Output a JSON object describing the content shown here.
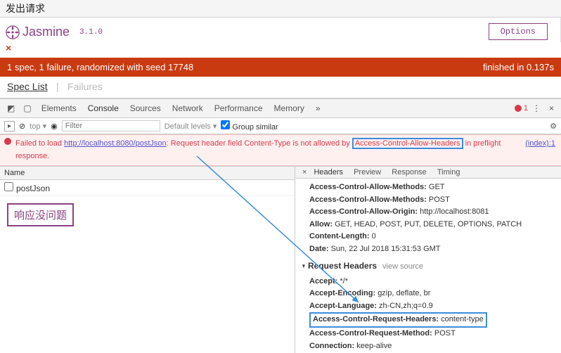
{
  "page": {
    "title": "发出请求"
  },
  "jasmine": {
    "name": "Jasmine",
    "version": "3.1.0",
    "options_label": "Options",
    "fail_mark": "×",
    "status_text": "1 spec, 1 failure, randomized with seed 17748",
    "finished_text": "finished in 0.137s",
    "spec_list_label": "Spec List",
    "failures_label": "Failures"
  },
  "devtools": {
    "tabs": [
      "Elements",
      "Console",
      "Sources",
      "Network",
      "Performance",
      "Memory"
    ],
    "active_tab": "Console",
    "overflow": "»",
    "error_count": "1",
    "more": "⋮",
    "close": "×"
  },
  "filter": {
    "context_label": "top",
    "filter_placeholder": "Filter",
    "levels_label": "Default levels",
    "group_label": "Group similar"
  },
  "console_error": {
    "prefix": "Failed to load ",
    "url": "http://localhost:8080/postJson",
    "mid1": ": Request header field Content-Type is not allowed by ",
    "boxed": "Access-Control-Allow-Headers",
    "mid2": " in preflight response.",
    "source": "(index):1"
  },
  "network": {
    "name_header": "Name",
    "request_name": "postJson",
    "note": "响应没问题"
  },
  "response_panel": {
    "tabs": [
      "Headers",
      "Preview",
      "Response",
      "Timing"
    ],
    "active": "Headers",
    "response_headers": [
      {
        "k": "Access-Control-Allow-Methods:",
        "v": "GET"
      },
      {
        "k": "Access-Control-Allow-Methods:",
        "v": "POST"
      },
      {
        "k": "Access-Control-Allow-Origin:",
        "v": "http://localhost:8081"
      },
      {
        "k": "Allow:",
        "v": "GET, HEAD, POST, PUT, DELETE, OPTIONS, PATCH"
      },
      {
        "k": "Content-Length:",
        "v": "0"
      },
      {
        "k": "Date:",
        "v": "Sun, 22 Jul 2018 15:31:53 GMT"
      }
    ],
    "request_headers_label": "Request Headers",
    "view_source": "view source",
    "request_headers": [
      {
        "k": "Accept:",
        "v": "*/*"
      },
      {
        "k": "Accept-Encoding:",
        "v": "gzip, deflate, br"
      },
      {
        "k": "Accept-Language:",
        "v": "zh-CN,zh;q=0.9",
        "gray": true
      },
      {
        "k": "Access-Control-Request-Headers:",
        "v": "content-type",
        "boxed": true
      },
      {
        "k": "Access-Control-Request-Method:",
        "v": "POST"
      },
      {
        "k": "Connection:",
        "v": "keep-alive"
      }
    ]
  }
}
